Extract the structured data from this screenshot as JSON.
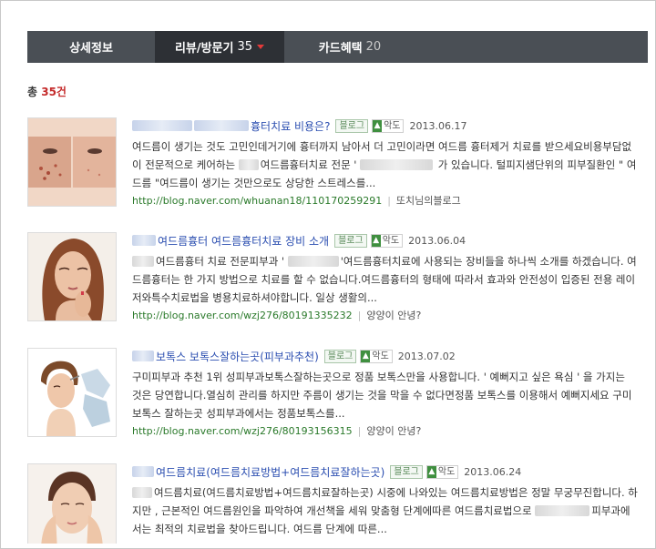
{
  "tabs": [
    {
      "label": "상세정보",
      "count": ""
    },
    {
      "label": "리뷰/방문기",
      "count": "35"
    },
    {
      "label": "카드혜택",
      "count": "20"
    }
  ],
  "total": {
    "prefix": "총",
    "count": "35건"
  },
  "results": [
    {
      "title": "흉터치료 비용은?",
      "badge": "블로그",
      "grade": "악도",
      "date": "2013.06.17",
      "desc_a": "여드름이 생기는 것도 고민인데거기에 흉터까지 남아서 더 고민이라면 여드름 흉터제거 치료를 받으세요비용부담없이 전문적으로 케어하는",
      "desc_b": "여드름흉터치료 전문",
      "desc_c": "가 있습니다. 털피지샘단위의 피부질환인 \" 여드름 \"여드름이 생기는 것만으로도 상당한 스트레스를...",
      "url": "http://blog.naver.com/whuanan18/110170259291",
      "author": "또치님의블로그"
    },
    {
      "title": "여드름흉터 여드름흉터치료 장비 소개",
      "badge": "블로그",
      "grade": "악도",
      "date": "2013.06.04",
      "desc_a": "여드름흉터 치료 전문피부과 '",
      "desc_b": "'여드름흉터치료에 사용되는 장비들을 하나씩 소개를 하겠습니다. 여드름흉터는 한 가지 방법으로 치료를 할 수 없습니다.여드름흉터의 형태에 따라서 효과와 안전성이 입증된 전용 레이저와특수치료법을 병용치료하셔야합니다. 일상 생활의...",
      "desc_c": "",
      "url": "http://blog.naver.com/wzj276/80191335232",
      "author": "양양이 안녕?"
    },
    {
      "title": "보톡스 보톡스잘하는곳(피부과추천)",
      "badge": "블로그",
      "grade": "악도",
      "date": "2013.07.02",
      "desc_a": "구미피부과 추천 1위 성피부과보톡스잘하는곳으로 정품 보톡스만을 사용합니다. ' 예뻐지고 싶은 욕심 ' 을 가지는 것은 당연합니다.열심히 관리를 하지만 주름이 생기는 것을 막을 수 없다면정품 보톡스를 이용해서 예뻐지세요 구미보톡스 잘하는곳 성피부과에서는 정품보톡스를...",
      "desc_b": "",
      "desc_c": "",
      "url": "http://blog.naver.com/wzj276/80193156315",
      "author": "양양이 안녕?"
    },
    {
      "title": "여드름치료(여드름치료방법+여드름치료잘하는곳)",
      "badge": "블로그",
      "grade": "악도",
      "date": "2013.06.24",
      "desc_a": "여드름치료(여드름치료방법+여드름치료잘하는곳) 시중에 나와있는 여드름치료방법은 정말 무궁무진합니다. 하지만 , 근본적인 여드름원인을 파악하여 개선책을 세워 맞춤형 단계에따른 여드름치료법으로",
      "desc_b": "피부과에서는 최적의 치료법을 찾아드립니다. 여드름 단계에 따른...",
      "desc_c": "",
      "url": "",
      "author": ""
    }
  ],
  "colors": {
    "tab_bar": "#4a4f55",
    "tab_active": "#2d3035",
    "link": "#2b4eb0",
    "url": "#2b7a2b",
    "count_red": "#c42a2a"
  },
  "icons": {
    "caret": "caret-down-icon",
    "grade": "grade-icon"
  }
}
